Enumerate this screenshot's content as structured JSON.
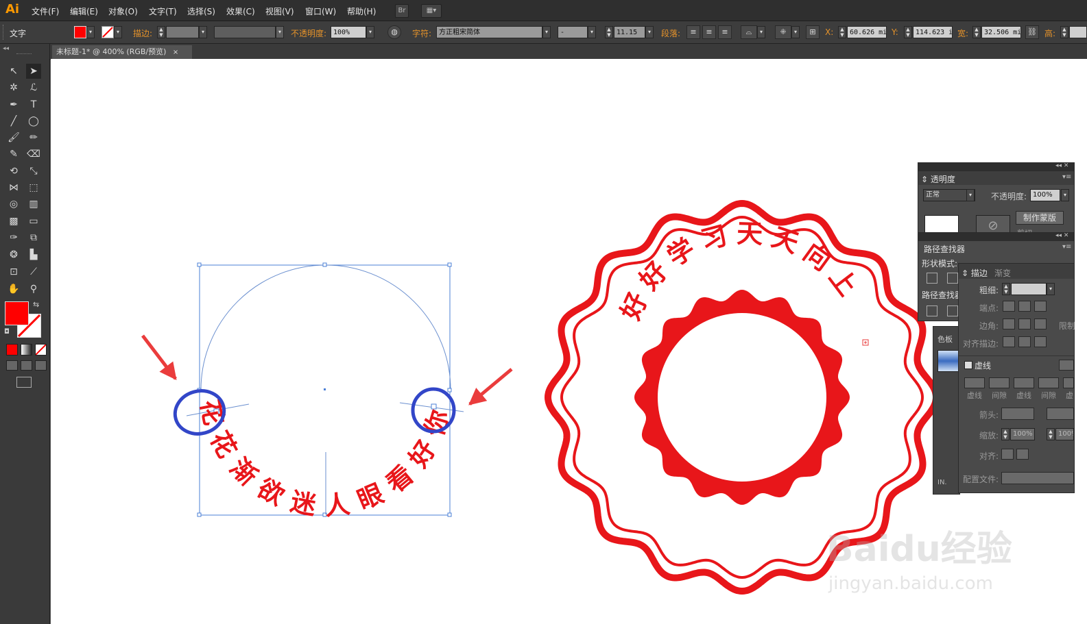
{
  "app": {
    "logo": "Ai"
  },
  "menu": {
    "items": [
      "文件(F)",
      "编辑(E)",
      "对象(O)",
      "文字(T)",
      "选择(S)",
      "效果(C)",
      "视图(V)",
      "窗口(W)",
      "帮助(H)"
    ],
    "bridge_label": "Br"
  },
  "controlbar": {
    "mode_label": "文字",
    "fill_color": "#ff0000",
    "stroke_label": "描边:",
    "opacity_label": "不透明度:",
    "opacity_value": "100%",
    "char_label": "字符:",
    "font_name": "方正粗宋简体",
    "font_style": "-",
    "font_size": "11.15",
    "para_label": "段落:",
    "x_label": "X:",
    "x_value": "60.626 mi",
    "y_label": "Y:",
    "y_value": "114.623 i",
    "w_label": "宽:",
    "w_value": "32.506 mi",
    "h_label": "高:"
  },
  "document_tab": {
    "title": "未标题-1* @ 400% (RGB/预览)",
    "close": "×"
  },
  "colors": {
    "accent": "#ff0000",
    "annotation": "#3246c8",
    "selection": "#4a7fd6",
    "arrow": "#ea3c3c"
  },
  "artwork": {
    "path_text": "花花渐欲迷人眼看好你",
    "seal_text": "好好学习天天向上"
  },
  "transparency_panel": {
    "title": "透明度",
    "blend_mode": "正常",
    "opacity_label": "不透明度:",
    "opacity_value": "100%",
    "make_mask": "制作蒙版",
    "clip_label": "剪切"
  },
  "pathfinder_panel": {
    "title": "路径查找器",
    "shape_modes": "形状模式:",
    "pathfinders": "路径查找器"
  },
  "swatches_tab": "色板",
  "stroke_panel": {
    "tab_stroke": "描边",
    "tab_gradient": "渐变",
    "weight_label": "粗细:",
    "cap_label": "端点:",
    "corner_label": "边角:",
    "limit_label": "限制",
    "align_label": "对齐描边:",
    "dashed_label": "虚线",
    "dash_labels": [
      "虚线",
      "间隙",
      "虚线",
      "间隙",
      "虚"
    ],
    "arrow_label": "箭头:",
    "scale_label": "缩放:",
    "scale_value1": "100%",
    "scale_value2": "100%",
    "align2_label": "对齐:",
    "profile_label": "配置文件:"
  },
  "watermark": {
    "brand": "Baidu经验",
    "url": "jingyan.baidu.com"
  }
}
